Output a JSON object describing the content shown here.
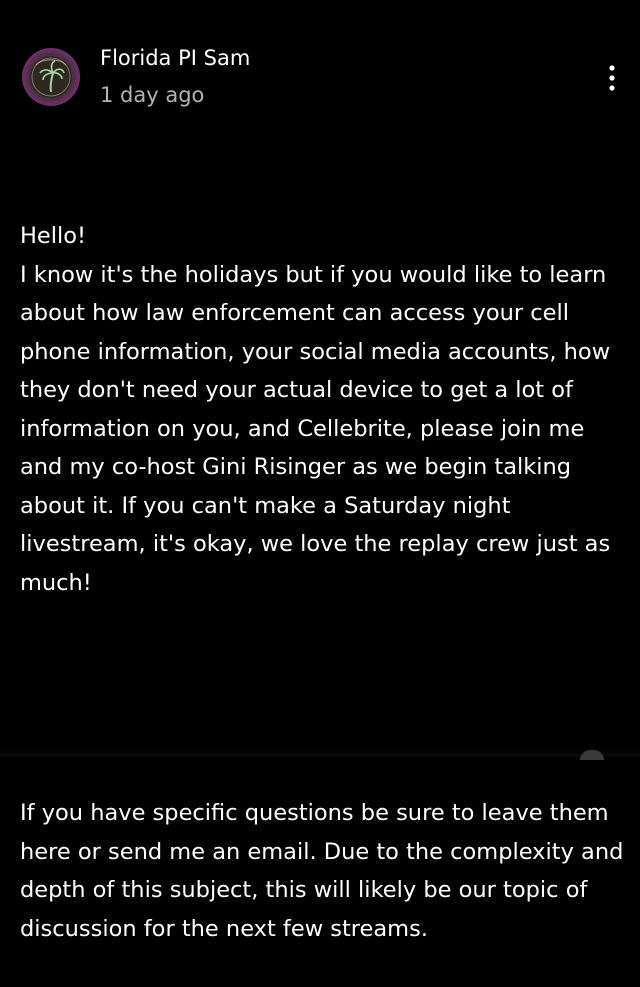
{
  "post": {
    "author": "Florida PI Sam",
    "timestamp": "1 day ago",
    "avatar_icon": "palm-tree-logo",
    "more_icon": "more-vertical-icon",
    "paragraphs": [
      "Hello!\nI know it's the holidays but if you would like to learn about how law enforcement can access your cell phone information, your social media accounts, how they don't need your actual device to get a lot of information on you, and Cellebrite, please join me and my co-host Gini Risinger as we begin talking about it. If you can't make a Saturday night livestream, it's okay, we love the replay crew just as much!",
      "If you have specific questions be sure to leave them here or send me an email. Due to the complexity and depth of this subject, this will likely be our topic of discussion for the next few streams."
    ]
  },
  "colors": {
    "background": "#000000",
    "text_primary": "#ffffff",
    "text_secondary": "#b3b3b3",
    "avatar_ring": "#c23bb3"
  }
}
